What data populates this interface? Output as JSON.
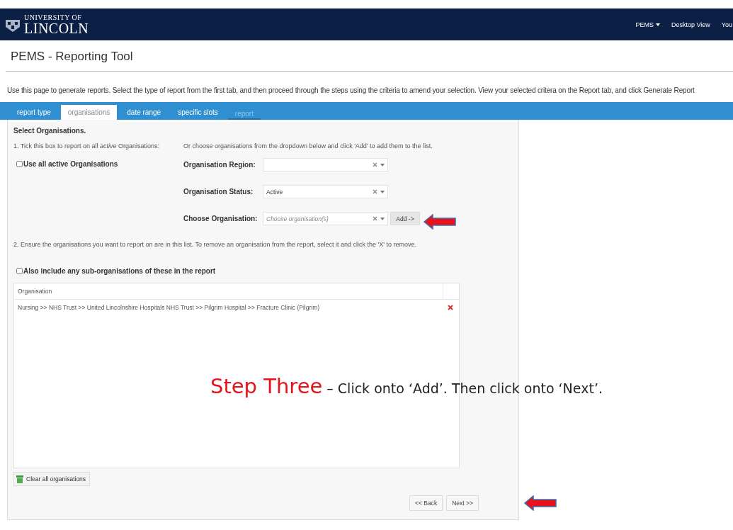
{
  "header": {
    "logo_line1": "UNIVERSITY OF",
    "logo_line2": "LINCOLN",
    "nav": [
      {
        "label": "PEMS",
        "dropdown": true
      },
      {
        "label": "Desktop View",
        "dropdown": false
      },
      {
        "label": "You",
        "dropdown": false
      }
    ]
  },
  "page_title": "PEMS - Reporting Tool",
  "intro": "Use this page to generate reports. Select the type of report from the first tab, and then proceed through the steps using the criteria to amend your selection. View your selected critera on the Report tab, and click Generate Report",
  "tabs": [
    {
      "label": "report type",
      "selected": false,
      "disabled": false
    },
    {
      "label": "organisations",
      "selected": true,
      "disabled": false
    },
    {
      "label": "date range",
      "selected": false,
      "disabled": false
    },
    {
      "label": "specific slots",
      "selected": false,
      "disabled": false
    },
    {
      "label": "report",
      "selected": false,
      "disabled": true
    }
  ],
  "section_title": "Select Organisations.",
  "step1": "1. Tick this box to report on all *active* Organisations:",
  "step1_alt": "Or choose organisations from the dropdown below and click 'Add' to add them to the list.",
  "use_all": {
    "label": "Use all active Organisations",
    "checked": false
  },
  "fields": [
    {
      "label": "Organisation Region:"
    },
    {
      "label": "Organisation Status:",
      "value": "Active"
    },
    {
      "label": "Choose Organisation:",
      "placeholder": "Choose organisation(s)",
      "button": "Add ->"
    }
  ],
  "step2": "2. Ensure the organisations you want to report on are in this list. To remove an organisation from the report, select it and click the 'X' to remove.",
  "include_sub": {
    "label": "Also include any sub-organisations of these in the report",
    "checked": false
  },
  "table": {
    "columns": [
      "Organisation"
    ],
    "rows": [
      "Nursing >> NHS Trust >> United Lincolnshire Hospitals NHS Trust >> Pilgrim Hospital >> Fracture Clinic (Pilgrim)"
    ]
  },
  "clear_button": "Clear all organisations",
  "nav_buttons": [
    "<< Back",
    "Next >>"
  ],
  "annotation": {
    "step": "Step Three",
    "text": "– Click onto ‘Add’.  Then click onto ‘Next’."
  }
}
